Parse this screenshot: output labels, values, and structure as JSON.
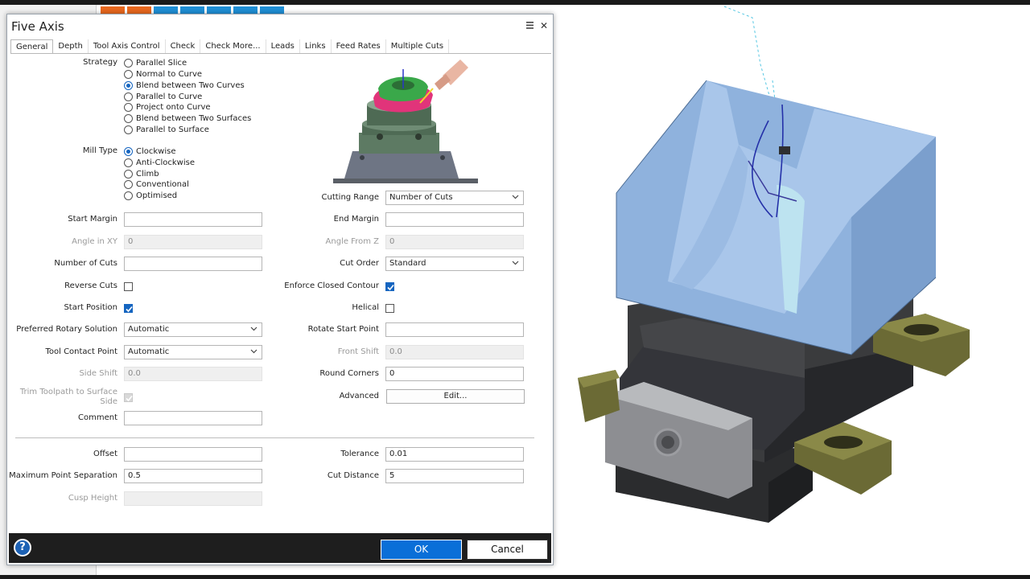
{
  "dialog": {
    "title": "Five Axis",
    "tabs": [
      "General",
      "Depth",
      "Tool Axis Control",
      "Check",
      "Check More...",
      "Leads",
      "Links",
      "Feed Rates",
      "Multiple Cuts"
    ]
  },
  "strategy": {
    "label": "Strategy",
    "options": [
      "Parallel Slice",
      "Normal to Curve",
      "Blend between Two Curves",
      "Parallel to Curve",
      "Project onto Curve",
      "Blend between Two Surfaces",
      "Parallel to Surface"
    ],
    "selected": "Blend between Two Curves"
  },
  "mill_type": {
    "label": "Mill Type",
    "options": [
      "Clockwise",
      "Anti-Clockwise",
      "Climb",
      "Conventional",
      "Optimised"
    ],
    "selected": "Clockwise"
  },
  "left": {
    "start_margin": {
      "label": "Start Margin",
      "value": ""
    },
    "angle_in_xy": {
      "label": "Angle in XY",
      "value": "0"
    },
    "number_of_cuts": {
      "label": "Number of Cuts",
      "value": ""
    },
    "reverse_cuts": {
      "label": "Reverse Cuts",
      "checked": false
    },
    "start_position": {
      "label": "Start Position",
      "checked": true
    },
    "preferred_rotary": {
      "label": "Preferred Rotary Solution",
      "value": "Automatic"
    },
    "tool_contact_point": {
      "label": "Tool Contact Point",
      "value": "Automatic"
    },
    "side_shift": {
      "label": "Side Shift",
      "value": "0.0"
    },
    "trim_toolpath": {
      "label_line1": "Trim Toolpath to Surface",
      "label_line2": "Side",
      "checked": true
    },
    "comment": {
      "label": "Comment",
      "value": ""
    }
  },
  "right": {
    "cutting_range": {
      "label": "Cutting Range",
      "value": "Number of Cuts"
    },
    "end_margin": {
      "label": "End Margin",
      "value": ""
    },
    "angle_from_z": {
      "label": "Angle From Z",
      "value": "0"
    },
    "cut_order": {
      "label": "Cut Order",
      "value": "Standard"
    },
    "enforce_closed_contour": {
      "label": "Enforce Closed Contour",
      "checked": true
    },
    "helical": {
      "label": "Helical",
      "checked": false
    },
    "rotate_start_point": {
      "label": "Rotate Start Point",
      "value": ""
    },
    "front_shift": {
      "label": "Front Shift",
      "value": "0.0"
    },
    "round_corners": {
      "label": "Round Corners",
      "value": "0"
    },
    "advanced": {
      "label": "Advanced",
      "button": "Edit..."
    }
  },
  "bottom": {
    "offset": {
      "label": "Offset",
      "value": ""
    },
    "max_point_separation": {
      "label": "Maximum Point Separation",
      "value": "0.5"
    },
    "cusp_height": {
      "label": "Cusp Height",
      "value": ""
    },
    "tolerance": {
      "label": "Tolerance",
      "value": "0.01"
    },
    "cut_distance": {
      "label": "Cut Distance",
      "value": "5"
    }
  },
  "footer": {
    "help": "?",
    "ok": "OK",
    "cancel": "Cancel"
  },
  "colors": {
    "accent": "#0a6fd8",
    "footer_bg": "#1e1e1e",
    "part_blue": "#8fb2dd",
    "fixture_dark": "#2e2f31",
    "clamp_olive": "#6b6a35"
  }
}
